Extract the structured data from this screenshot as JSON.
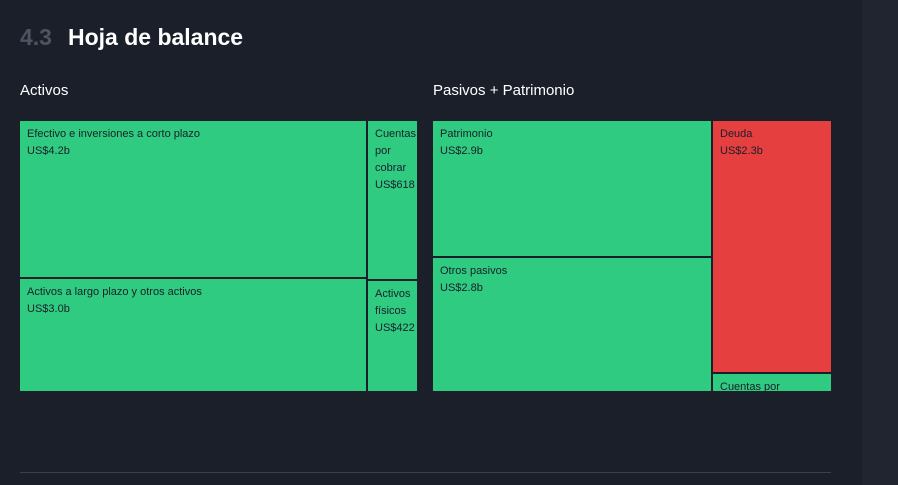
{
  "section": {
    "number": "4.3",
    "title": "Hoja de balance"
  },
  "colors": {
    "green": "#2ecb80",
    "red": "#e5403f",
    "gap": "#1b1f2a"
  },
  "chart_data": [
    {
      "type": "treemap",
      "title": "Activos",
      "items": [
        {
          "name": "Efectivo e inversiones a corto plazo",
          "value_label": "US$4.2b",
          "value": 4.2,
          "color": "green"
        },
        {
          "name": "Activos a largo plazo y otros activos",
          "value_label": "US$3.0b",
          "value": 3.0,
          "color": "green"
        },
        {
          "name": "Cuentas por cobrar",
          "value_label": "US$618",
          "value": 0.618,
          "color": "green"
        },
        {
          "name": "Activos físicos",
          "value_label": "US$422",
          "value": 0.422,
          "color": "green"
        }
      ]
    },
    {
      "type": "treemap",
      "title": "Pasivos + Patrimonio",
      "items": [
        {
          "name": "Patrimonio",
          "value_label": "US$2.9b",
          "value": 2.9,
          "color": "green"
        },
        {
          "name": "Otros pasivos",
          "value_label": "US$2.8b",
          "value": 2.8,
          "color": "green"
        },
        {
          "name": "Deuda",
          "value_label": "US$2.3b",
          "value": 2.3,
          "color": "red"
        },
        {
          "name": "Cuentas por",
          "value_label": "",
          "value": 0.35,
          "color": "green"
        }
      ]
    }
  ]
}
